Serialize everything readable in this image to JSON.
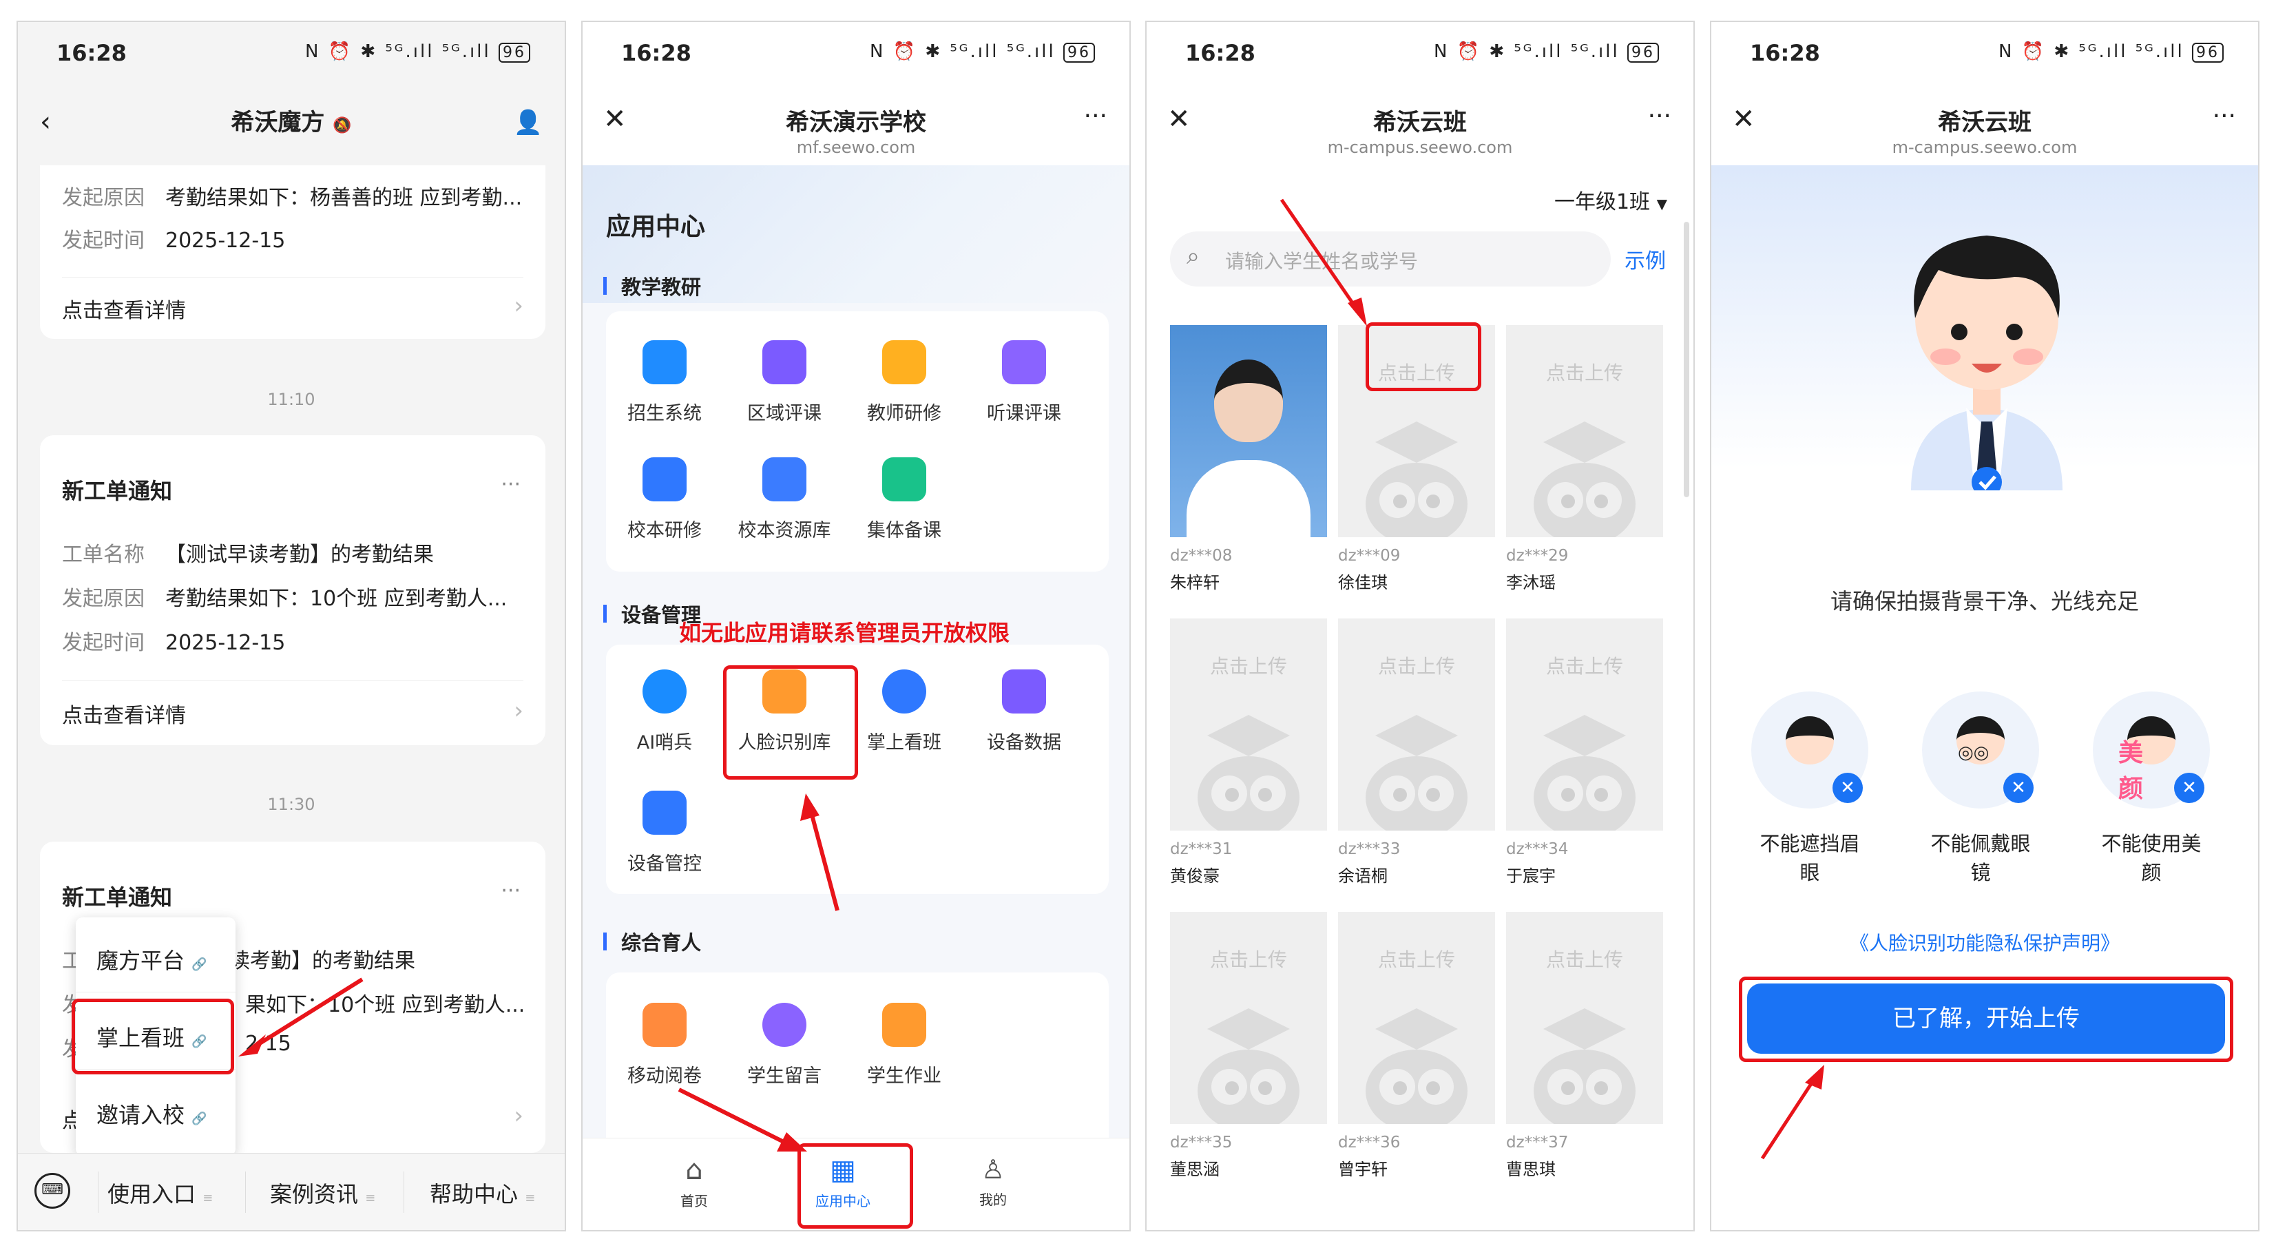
{
  "status": {
    "time": "16:28",
    "icons": "N ⏰ ✱ ⁵ᴳ.ıll ⁵ᴳ.ıll",
    "battery": "96"
  },
  "p1": {
    "title": "希沃魔方",
    "card1": {
      "rows": [
        {
          "k": "发起原因",
          "v": "考勤结果如下：杨善善的班 应到考勤..."
        },
        {
          "k": "发起时间",
          "v": "2025-12-15"
        }
      ],
      "link": "点击查看详情"
    },
    "time1": "11:10",
    "card2": {
      "title": "新工单通知",
      "rows": [
        {
          "k": "工单名称",
          "v": "【测试早读考勤】的考勤结果"
        },
        {
          "k": "发起原因",
          "v": "考勤结果如下：10个班 应到考勤人..."
        },
        {
          "k": "发起时间",
          "v": "2025-12-15"
        }
      ],
      "link": "点击查看详情"
    },
    "time2": "11:30",
    "card3": {
      "title": "新工单通知",
      "row1_k": "工",
      "row1_v": "读考勤】的考勤结果",
      "row2_k": "发",
      "row2_v": "果如下：10个班 应到考勤人...",
      "row3_k": "发",
      "row3_v": "2 15",
      "link_k": "点"
    },
    "menu": [
      "魔方平台",
      "掌上看班",
      "邀请入校"
    ],
    "bottom": [
      "使用入口",
      "案例资讯",
      "帮助中心"
    ]
  },
  "p2": {
    "title": "希沃演示学校",
    "sub": "mf.seewo.com",
    "heading": "应用中心",
    "sections": [
      {
        "name": "教学教研",
        "apps": [
          "招生系统",
          "区域评课",
          "教师研修",
          "听课评课",
          "校本研修",
          "校本资源库",
          "集体备课"
        ]
      },
      {
        "name": "设备管理",
        "apps": [
          "AI哨兵",
          "人脸识别库",
          "掌上看班",
          "设备数据",
          "设备管控"
        ]
      },
      {
        "name": "综合育人",
        "apps": [
          "移动阅卷",
          "学生留言",
          "学生作业"
        ]
      }
    ],
    "note": "如无此应用请联系管理员开放权限",
    "tabs": [
      "首页",
      "应用中心",
      "我的"
    ]
  },
  "p3": {
    "title": "希沃云班",
    "sub": "m-campus.seewo.com",
    "class": "一年级1班",
    "search_placeholder": "请输入学生姓名或学号",
    "sample": "示例",
    "upload": "点击上传",
    "students": [
      {
        "id": "dz***08",
        "name": "朱梓轩"
      },
      {
        "id": "dz***09",
        "name": "徐佳琪"
      },
      {
        "id": "dz***29",
        "name": "李沐瑶"
      },
      {
        "id": "dz***31",
        "name": "黄俊豪"
      },
      {
        "id": "dz***33",
        "name": "余语桐"
      },
      {
        "id": "dz***34",
        "name": "于宸宇"
      },
      {
        "id": "dz***35",
        "name": "董思涵"
      },
      {
        "id": "dz***36",
        "name": "曾宇轩"
      },
      {
        "id": "dz***37",
        "name": "曹思琪"
      }
    ]
  },
  "p4": {
    "title": "希沃云班",
    "sub": "m-campus.seewo.com",
    "tip": "请确保拍摄背景干净、光线充足",
    "rules": [
      "不能遮挡眉眼",
      "不能佩戴眼镜",
      "不能使用美颜"
    ],
    "beauty": "美颜",
    "privacy": "《人脸识别功能隐私保护声明》",
    "button": "已了解，开始上传"
  },
  "colors": {
    "accent": "#1a73f5",
    "red": "#e8141a"
  }
}
